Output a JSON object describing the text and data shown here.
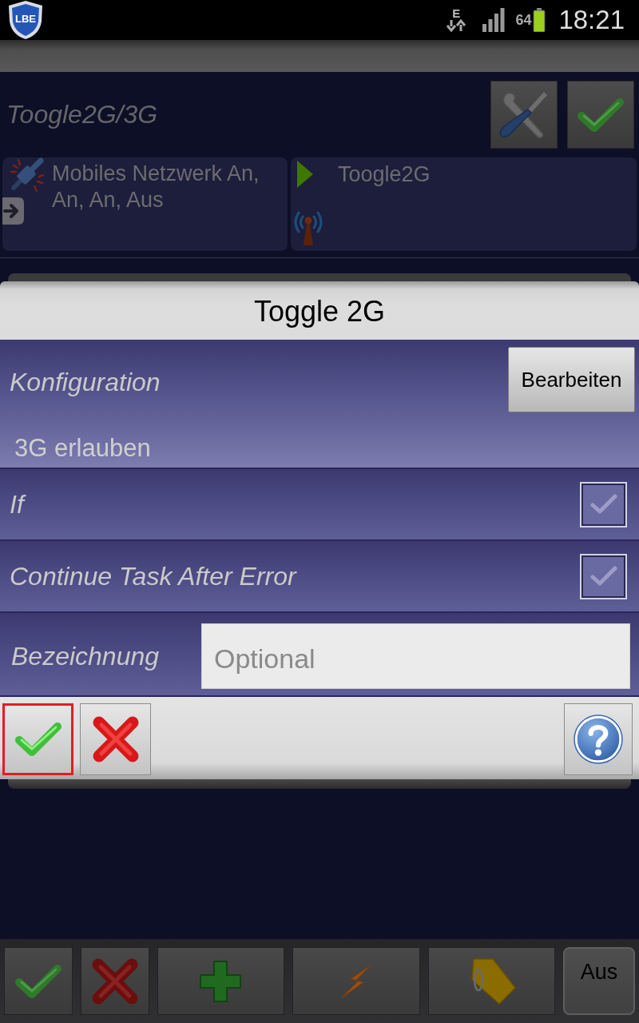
{
  "status_bar": {
    "app_badge": "LBE",
    "network_type": "E",
    "battery_percent": "64",
    "time": "18:21"
  },
  "task": {
    "title": "Toogle2G/3G",
    "header_buttons": [
      {
        "kind": "tools"
      },
      {
        "kind": "check"
      }
    ],
    "cards": [
      {
        "kind": "action",
        "text": "Mobiles Netzwerk An, An, An, Aus"
      },
      {
        "kind": "task",
        "text": "Toogle2G"
      }
    ]
  },
  "dialog": {
    "title": "Toggle 2G",
    "config": {
      "label": "Konfiguration",
      "button": "Bearbeiten",
      "value": "3G erlauben"
    },
    "options": [
      {
        "label": "If",
        "checked": true
      },
      {
        "label": "Continue Task After Error",
        "checked": true
      }
    ],
    "name_field": {
      "label": "Bezeichnung",
      "placeholder": "Optional"
    },
    "buttons": [
      {
        "kind": "ok",
        "focused": true
      },
      {
        "kind": "cancel",
        "focused": false
      },
      {
        "kind": "help",
        "focused": false
      }
    ]
  },
  "toolbar": [
    {
      "kind": "check"
    },
    {
      "kind": "cancel"
    },
    {
      "kind": "add"
    },
    {
      "kind": "flash"
    },
    {
      "kind": "tag"
    },
    {
      "kind": "text",
      "label": "Aus"
    }
  ]
}
